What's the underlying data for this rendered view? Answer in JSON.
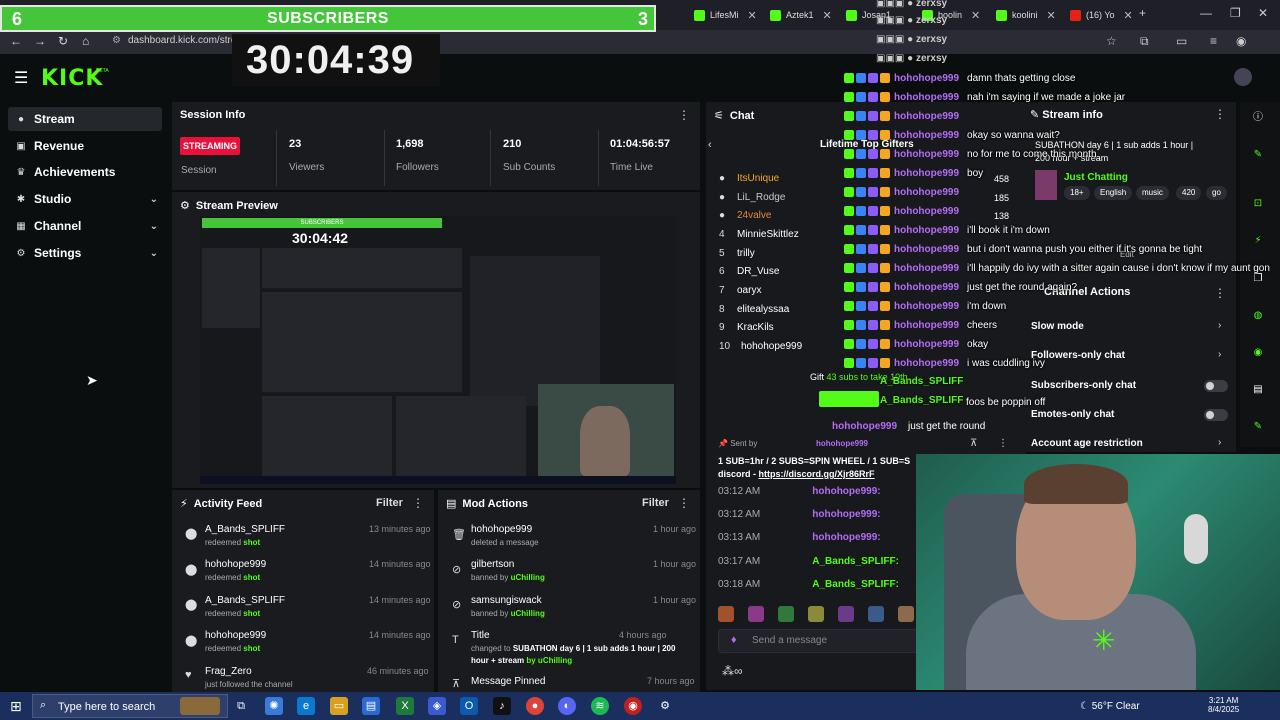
{
  "overlay": {
    "subs_left": "6",
    "subs_title": "SUBSCRIBERS",
    "subs_right": "3",
    "timer": "30:04:39"
  },
  "browser": {
    "tabs": [
      "LifesMi",
      "Aztek1",
      "Josan1",
      "boolin",
      "koolini",
      "(16) Yo"
    ],
    "url": "dashboard.kick.com/strea"
  },
  "header": {
    "logo": "KICK",
    "beta": "BETA"
  },
  "sidebar": {
    "items": [
      {
        "label": "Stream",
        "icon": "stream-icon"
      },
      {
        "label": "Revenue",
        "icon": "revenue-icon"
      },
      {
        "label": "Achievements",
        "icon": "trophy-icon"
      },
      {
        "label": "Studio",
        "icon": "studio-icon"
      },
      {
        "label": "Channel",
        "icon": "channel-icon"
      },
      {
        "label": "Settings",
        "icon": "gear-icon"
      }
    ]
  },
  "session": {
    "title": "Session Info",
    "status": "STREAMING",
    "status_label": "Session",
    "stats": [
      {
        "value": "23",
        "label": "Viewers"
      },
      {
        "value": "1,698",
        "label": "Followers"
      },
      {
        "value": "210",
        "label": "Sub Counts"
      },
      {
        "value": "01:04:56:57",
        "label": "Time Live"
      }
    ]
  },
  "preview": {
    "title": "Stream Preview",
    "subs": "SUBSCRIBERS",
    "timer": "30:04:42"
  },
  "activity": {
    "title": "Activity Feed",
    "filter": "Filter",
    "items": [
      {
        "name": "A_Bands_SPLIFF",
        "action": "redeemed",
        "reward": "shot",
        "time": "13 minutes ago"
      },
      {
        "name": "hohohope999",
        "action": "redeemed",
        "reward": "shot",
        "time": "14 minutes ago"
      },
      {
        "name": "A_Bands_SPLIFF",
        "action": "redeemed",
        "reward": "shot",
        "time": "14 minutes ago"
      },
      {
        "name": "hohohope999",
        "action": "redeemed",
        "reward": "shot",
        "time": "14 minutes ago"
      },
      {
        "name": "Frag_Zero",
        "action": "just followed the channel",
        "reward": "",
        "time": "46 minutes ago"
      }
    ]
  },
  "mod": {
    "title": "Mod Actions",
    "filter": "Filter",
    "items": [
      {
        "name": "hohohope999",
        "sub": "deleted a message",
        "by": "",
        "time": "1 hour ago"
      },
      {
        "name": "gilbertson",
        "sub": "banned by",
        "by": "uChilling",
        "time": "1 hour ago"
      },
      {
        "name": "samsungiswack",
        "sub": "banned by",
        "by": "uChilling",
        "time": "1 hour ago"
      },
      {
        "name": "Title",
        "sub": "changed to",
        "by": "SUBATHON day 6 | 1 sub adds 1 hour | 200",
        "by2": "hour + stream",
        "by3": "by uChilling",
        "time": "4 hours ago"
      },
      {
        "name": "Message Pinned",
        "sub": "",
        "by": "",
        "time": "7 hours ago"
      }
    ]
  },
  "chat": {
    "title": "Chat",
    "gifters_title": "Lifetime Top Gifters",
    "gifters": [
      "ItsUnique",
      "LiL_Rodge",
      "24valve",
      "MinnieSkittlez",
      "trilly",
      "DR_Vuse",
      "oaryx",
      "elitealyssaa",
      "KracKils",
      "hohohope999"
    ],
    "gifter_counts": [
      "458",
      "185",
      "138"
    ],
    "ranks": [
      "4",
      "5",
      "6",
      "7",
      "8",
      "9",
      "10"
    ],
    "zerxsy": [
      "zerxsy",
      "zerxsy",
      "zerxsy",
      "zerxsy"
    ],
    "lines": [
      {
        "user": "hohohope999",
        "msg": "damn thats getting close"
      },
      {
        "user": "hohohope999",
        "msg": "nah i'm saying if we made a joke jar"
      },
      {
        "user": "hohohope999",
        "msg": ""
      },
      {
        "user": "hohohope999",
        "msg": "okay so wanna wait?"
      },
      {
        "user": "hohohope999",
        "msg": "no for me to come this month"
      },
      {
        "user": "hohohope999",
        "msg": "boy"
      },
      {
        "user": "hohohope999",
        "msg": ""
      },
      {
        "user": "hohohope999",
        "msg": ""
      },
      {
        "user": "hohohope999",
        "msg": "i'll book it i'm down"
      },
      {
        "user": "hohohope999",
        "msg": "but i don't wanna push you either if it's gonna be tight"
      },
      {
        "user": "hohohope999",
        "msg": "i'll happily do ivy with a sitter again cause i don't know if my aunt gon"
      },
      {
        "user": "hohohope999",
        "msg": "just get the round again?"
      },
      {
        "user": "hohohope999",
        "msg": "i'm down"
      },
      {
        "user": "hohohope999",
        "msg": "cheers"
      },
      {
        "user": "hohohope999",
        "msg": "okay"
      },
      {
        "user": "hohohope999",
        "msg": "i was cuddling ivy"
      }
    ],
    "gift_label": "Gift",
    "gift_note": "43 subs to take 10th",
    "gift_users": [
      "A_Bands_SPLIFF",
      "A_Bands_SPLIFF"
    ],
    "gift_msg": "foos be poppin off",
    "pin_sent": "Sent by",
    "pin_user": "hohohope999",
    "pin_prev": "just get the round",
    "pin_line1": "1 SUB=1hr / 2 SUBS=SPIN WHEEL / 1 SUB=S",
    "pin_line2": "discord - ",
    "pin_link": "https://discord.gg/Xjr86RrF",
    "history": [
      {
        "time": "03:12 AM",
        "user": "hohohope999:"
      },
      {
        "time": "03:12 AM",
        "user": "hohohope999:"
      },
      {
        "time": "03:13 AM",
        "user": "hohohope999:"
      },
      {
        "time": "03:17 AM",
        "user": "A_Bands_SPLIFF:"
      },
      {
        "time": "03:18 AM",
        "user": "A_Bands_SPLIFF:"
      }
    ],
    "send_placeholder": "Send a message"
  },
  "stream_info": {
    "title": "Stream info",
    "stream_title": "SUBATHON day 6 | 1 sub adds 1 hour |",
    "stream_title2": "200 hour + stream",
    "category": "Just Chatting",
    "tags": [
      "18+",
      "English",
      "music",
      "420",
      "go"
    ],
    "edit": "Edit"
  },
  "channel_actions": {
    "title": "Channel Actions",
    "items": [
      "Slow mode",
      "Followers-only chat",
      "Subscribers-only chat",
      "Emotes-only chat",
      "Account age restriction"
    ]
  },
  "taskbar": {
    "search": "Type here to search",
    "weather": "56°F  Clear",
    "time": "3:21 AM",
    "date": "8/4/2025"
  }
}
